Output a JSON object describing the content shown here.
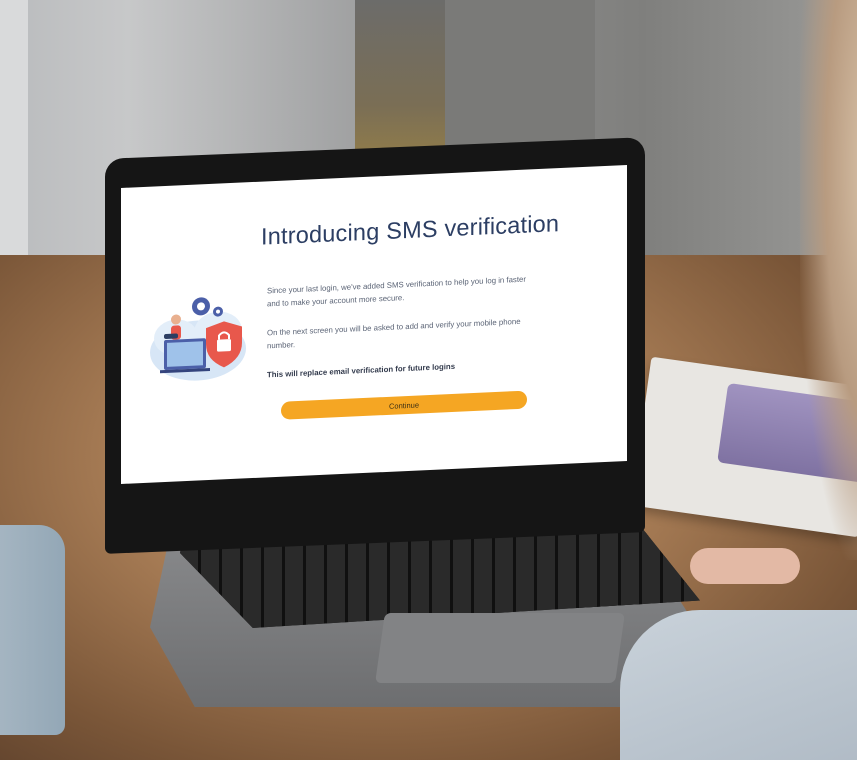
{
  "modal": {
    "title": "Introducing SMS verification",
    "paragraph_1": "Since your last login, we've added SMS verification to help you log in faster and to make your account more secure.",
    "paragraph_2": "On the next screen you will be asked to add and verify your mobile phone number.",
    "paragraph_3": "This will replace email verification for future logins",
    "continue_label": "Continue"
  },
  "colors": {
    "title": "#2c3e63",
    "button": "#f5a623",
    "shield": "#e8584c",
    "cloud": "#d7e6f6",
    "gear": "#4b5fa8"
  },
  "icons": {
    "illustration": "person-on-laptop-shield-lock-gears"
  }
}
